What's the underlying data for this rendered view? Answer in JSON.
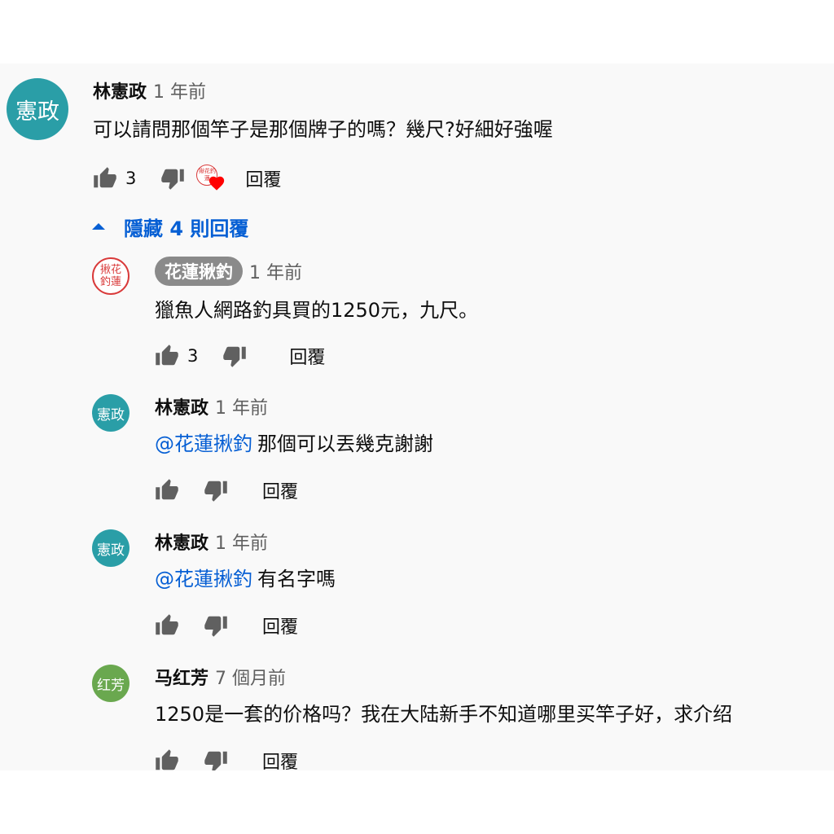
{
  "icons": {
    "like": "thumb-up-icon",
    "dislike": "thumb-down-icon",
    "caret": "caret-up-icon",
    "heart": "heart-icon"
  },
  "colors": {
    "link": "#065fd4",
    "teal_avatar": "#2a9ea7",
    "green_avatar": "#6aa84f",
    "heart": "#ff0000",
    "seal": "#d93a3a",
    "chip": "#8a8a8a"
  },
  "main_comment": {
    "avatar_text": "憲政",
    "author": "林憲政",
    "time": "1 年前",
    "text": "可以請問那個竿子是那個牌子的嗎？幾尺?好細好強喔",
    "likes": "3",
    "reply_label": "回覆",
    "creator_seal_text": "揪花釣蓮"
  },
  "toggle_replies": {
    "label": "隱藏 4 則回覆"
  },
  "replies": [
    {
      "avatar_text": "揪花釣蓮",
      "author": "花蓮揪釣",
      "time": "1 年前",
      "mention": "",
      "text": "獵魚人網路釣具買的1250元，九尺。",
      "likes": "3",
      "reply_label": "回覆"
    },
    {
      "avatar_text": "憲政",
      "author": "林憲政",
      "time": "1 年前",
      "mention": "@花蓮揪釣",
      "text": "那個可以丟幾克謝謝",
      "likes": "",
      "reply_label": "回覆"
    },
    {
      "avatar_text": "憲政",
      "author": "林憲政",
      "time": "1 年前",
      "mention": "@花蓮揪釣",
      "text": "有名字嗎",
      "likes": "",
      "reply_label": "回覆"
    },
    {
      "avatar_text": "红芳",
      "author": "马红芳",
      "time": "7 個月前",
      "mention": "",
      "text": "1250是一套的价格吗？我在大陆新手不知道哪里买竿子好，求介绍",
      "likes": "",
      "reply_label": "回覆"
    }
  ]
}
